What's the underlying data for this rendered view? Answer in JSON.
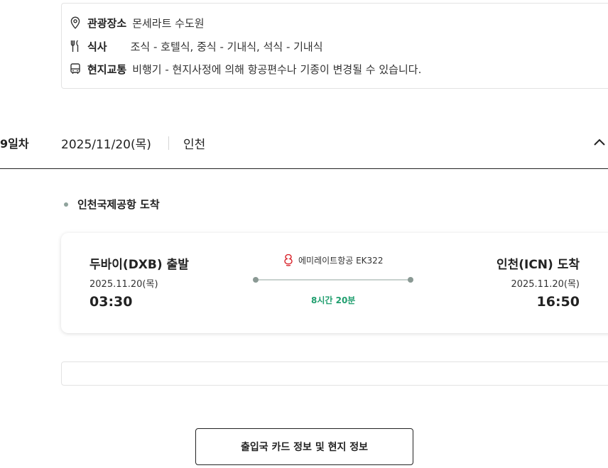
{
  "prev_day_info": {
    "sightseeing": {
      "label": "관광장소",
      "value": "몬세라트 수도원",
      "icon": "map-pin-icon"
    },
    "meals": {
      "label": "식사",
      "value": "조식 - 호텔식, 중식 - 기내식, 석식 - 기내식",
      "icon": "utensils-icon"
    },
    "transport": {
      "label": "현지교통",
      "value": "비행기 - 현지사정에 의해 항공편수나 기종이 변경될 수 있습니다.",
      "icon": "bus-icon"
    }
  },
  "day": {
    "number_label": "9일차",
    "date": "2025/11/20(목)",
    "city": "인천",
    "toggle_icon": "chevron-up-icon"
  },
  "event": {
    "title": "인천국제공항 도착"
  },
  "flight": {
    "departure": {
      "city": "두바이(DXB) 출발",
      "date": "2025.11.20(목)",
      "time": "03:30"
    },
    "arrival": {
      "city": "인천(ICN) 도착",
      "date": "2025.11.20(목)",
      "time": "16:50"
    },
    "airline": "에미레이트항공 EK322",
    "airline_logo_icon": "emirates-logo-icon",
    "duration": "8시간 20분",
    "accent_color": "#1f9e6e"
  },
  "buttons": {
    "entry_info": "출입국 카드 정보 및 현지 정보"
  }
}
